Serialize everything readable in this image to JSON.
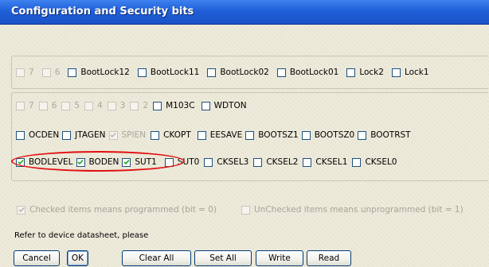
{
  "window": {
    "title": "Configuration and Security bits"
  },
  "lock_row": [
    {
      "label": "7",
      "checked": false,
      "disabled": true
    },
    {
      "label": "6",
      "checked": false,
      "disabled": true
    },
    {
      "label": "BootLock12",
      "checked": false,
      "disabled": false
    },
    {
      "label": "BootLock11",
      "checked": false,
      "disabled": false
    },
    {
      "label": "BootLock02",
      "checked": false,
      "disabled": false
    },
    {
      "label": "BootLock01",
      "checked": false,
      "disabled": false
    },
    {
      "label": "Lock2",
      "checked": false,
      "disabled": false
    },
    {
      "label": "Lock1",
      "checked": false,
      "disabled": false
    }
  ],
  "extended_row": [
    {
      "label": "7",
      "checked": false,
      "disabled": true
    },
    {
      "label": "6",
      "checked": false,
      "disabled": true
    },
    {
      "label": "5",
      "checked": false,
      "disabled": true
    },
    {
      "label": "4",
      "checked": false,
      "disabled": true
    },
    {
      "label": "3",
      "checked": false,
      "disabled": true
    },
    {
      "label": "2",
      "checked": false,
      "disabled": true
    },
    {
      "label": "M103C",
      "checked": false,
      "disabled": false
    },
    {
      "label": "WDTON",
      "checked": false,
      "disabled": false
    }
  ],
  "high_row": [
    {
      "label": "OCDEN",
      "checked": false,
      "disabled": false
    },
    {
      "label": "JTAGEN",
      "checked": false,
      "disabled": false
    },
    {
      "label": "SPIEN",
      "checked": true,
      "disabled": true
    },
    {
      "label": "CKOPT",
      "checked": false,
      "disabled": false
    },
    {
      "label": "EESAVE",
      "checked": false,
      "disabled": false
    },
    {
      "label": "BOOTSZ1",
      "checked": false,
      "disabled": false
    },
    {
      "label": "BOOTSZ0",
      "checked": false,
      "disabled": false
    },
    {
      "label": "BOOTRST",
      "checked": false,
      "disabled": false
    }
  ],
  "low_row": [
    {
      "label": "BODLEVEL",
      "checked": true,
      "disabled": false
    },
    {
      "label": "BODEN",
      "checked": true,
      "disabled": false
    },
    {
      "label": "SUT1",
      "checked": true,
      "disabled": false
    },
    {
      "label": "SUT0",
      "checked": false,
      "disabled": false
    },
    {
      "label": "CKSEL3",
      "checked": false,
      "disabled": false
    },
    {
      "label": "CKSEL2",
      "checked": false,
      "disabled": false
    },
    {
      "label": "CKSEL1",
      "checked": false,
      "disabled": false
    },
    {
      "label": "CKSEL0",
      "checked": false,
      "disabled": false
    }
  ],
  "legend": {
    "checked": "Checked items means programmed (bit = 0)",
    "unchecked": "UnChecked items means unprogrammed (bit = 1)"
  },
  "hint": "Refer to device datasheet, please",
  "buttons": {
    "cancel": "Cancel",
    "ok": "OK",
    "clear_all": "Clear All",
    "set_all": "Set All",
    "write": "Write",
    "read": "Read"
  },
  "colors": {
    "titlebar": "#1f5fd8",
    "highlight": "#e11010",
    "checkbox_border": "#1c5180",
    "checkmark": "#21a121"
  }
}
